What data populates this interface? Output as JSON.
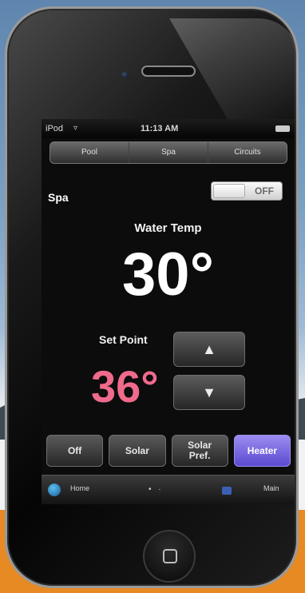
{
  "status_bar": {
    "carrier": "iPod",
    "wifi": "▿",
    "time": "11:13 AM"
  },
  "tabs": [
    {
      "label": "Pool"
    },
    {
      "label": "Spa"
    },
    {
      "label": "Circuits"
    }
  ],
  "spa": {
    "label": "Spa",
    "toggle_label": "OFF"
  },
  "water": {
    "label": "Water Temp",
    "value": "30°"
  },
  "setpoint": {
    "label": "Set Point",
    "value": "36°",
    "up_glyph": "▲",
    "down_glyph": "▼"
  },
  "modes": [
    {
      "label": "Off",
      "active": false
    },
    {
      "label": "Solar",
      "active": false
    },
    {
      "label": "Solar\nPref.",
      "active": false
    },
    {
      "label": "Heater",
      "active": true
    }
  ],
  "bottom_bar": {
    "home_label": "Home",
    "page_dots": "• ·",
    "main_label": "Main"
  },
  "colors": {
    "setpoint": "#f06a8c",
    "active_mode": "#6b5ae0",
    "accent_background": "#e78a24"
  }
}
